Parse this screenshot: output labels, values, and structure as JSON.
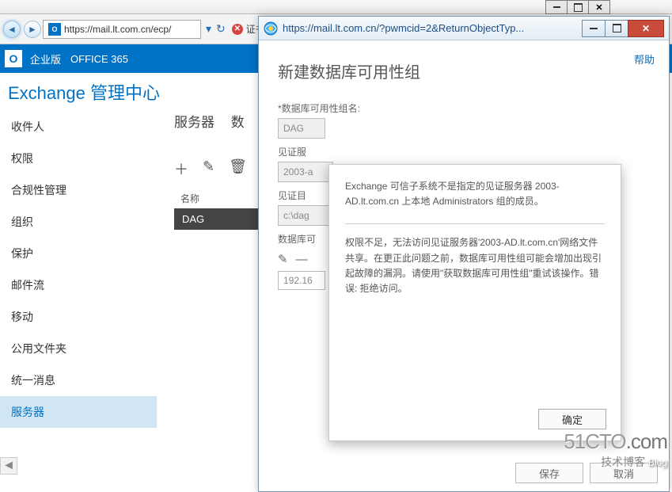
{
  "bg_window": {
    "url_display": "https://mail.lt.com.cn/ecp/",
    "cert_error": "证书..."
  },
  "o365": {
    "enterprise": "企业版",
    "product": "OFFICE 365"
  },
  "eac_title": "Exchange 管理中心",
  "nav": [
    "收件人",
    "权限",
    "合规性管理",
    "组织",
    "保护",
    "邮件流",
    "移动",
    "公用文件夹",
    "统一消息",
    "服务器"
  ],
  "nav_selected_index": 9,
  "tabs": {
    "t1": "服务器",
    "t2": "数"
  },
  "table": {
    "header": "名称",
    "row0": "DAG"
  },
  "popup": {
    "url": "https://mail.lt.com.cn/?pwmcid=2&ReturnObjectTyp...",
    "help": "帮助",
    "heading": "新建数据库可用性组",
    "labels": {
      "dag_name": "*数据库可用性组名:",
      "witness_server": "见证服",
      "witness_dir": "见证目",
      "dag_ip": "数据库可"
    },
    "inputs": {
      "dag_name": "DAG",
      "witness_server": "2003-a",
      "witness_dir": "c:\\dag",
      "ip": "192.16"
    },
    "buttons": {
      "save": "保存",
      "cancel": "取消"
    }
  },
  "modal": {
    "msg1": "Exchange 可信子系统不是指定的见证服务器 2003-AD.lt.com.cn 上本地 Administrators 组的成员。",
    "msg2": "权限不足，无法访问见证服务器'2003-AD.lt.com.cn'网络文件共享。在更正此问题之前，数据库可用性组可能会增加出现引起故障的漏洞。请使用\"获取数据库可用性组\"重试该操作。错误: 拒绝访问。",
    "ok": "确定"
  },
  "watermark": {
    "line1a": "51CTO",
    "line1b": ".com",
    "line2": "技术博客",
    "blog": "Blog"
  }
}
